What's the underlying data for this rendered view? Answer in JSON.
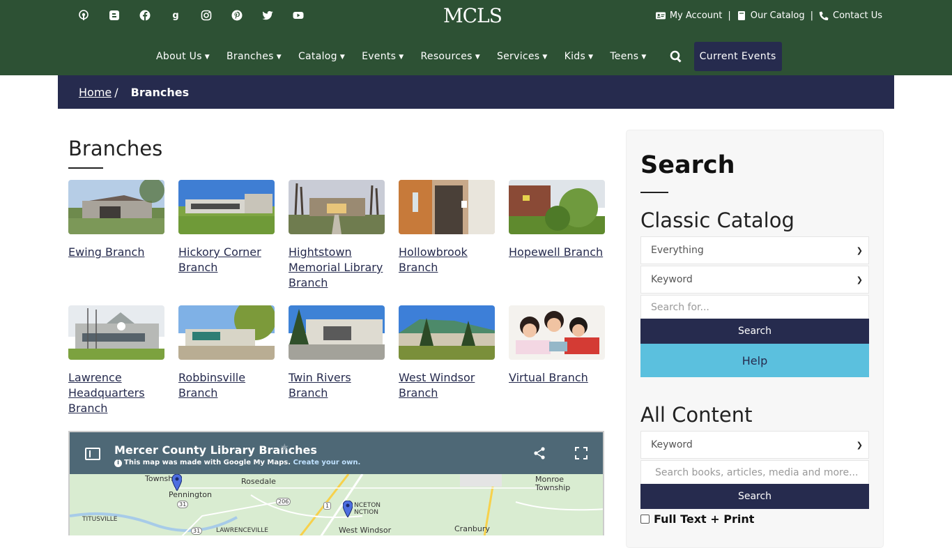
{
  "header": {
    "logo": "MCLS",
    "social_icons": [
      "podcast-icon",
      "blogger-icon",
      "facebook-icon",
      "goodreads-icon",
      "instagram-icon",
      "pinterest-icon",
      "twitter-icon",
      "youtube-icon"
    ],
    "social_glyphs": {
      "blogger": "B",
      "goodreads": "g"
    },
    "utility": {
      "account": "My Account",
      "catalog": "Our Catalog",
      "contact": "Contact Us",
      "separator": "|"
    },
    "nav": [
      "About Us",
      "Branches",
      "Catalog",
      "Events",
      "Resources",
      "Services",
      "Kids",
      "Teens"
    ],
    "current_events": "Current Events",
    "colors": {
      "header_bg": "#2d5134",
      "navy": "#262b4e",
      "help": "#5bc0de"
    }
  },
  "breadcrumb": {
    "home": "Home",
    "separator": "/",
    "current": "Branches"
  },
  "main": {
    "title": "Branches",
    "branches": [
      {
        "label": "Ewing Branch"
      },
      {
        "label": "Hickory Corner Branch"
      },
      {
        "label": "Hightstown Memorial Library Branch"
      },
      {
        "label": "Hollowbrook Branch"
      },
      {
        "label": "Hopewell Branch"
      },
      {
        "label": "Lawrence Headquarters Branch"
      },
      {
        "label": "Robbinsville Branch"
      },
      {
        "label": "Twin Rivers Branch"
      },
      {
        "label": "West Windsor Branch"
      },
      {
        "label": "Virtual Branch"
      }
    ],
    "map": {
      "title": "Mercer County Library Branches",
      "note": "This map was made with Google My Maps.",
      "note_link": "Create your own.",
      "labels": {
        "township": "Townsh",
        "pennington": "Pennington",
        "rosedale": "Rosedale",
        "titusville": "TITUSVILLE",
        "lawrenceville": "LAWRENCEVILLE",
        "princeton_junction": "NCETON\nNCTION",
        "west_windsor": "West Windsor",
        "monroe_township": "Monroe\nTownship",
        "cranbury": "Cranbury",
        "route_31": "31",
        "route_206": "206",
        "route_1": "1"
      }
    }
  },
  "sidebar": {
    "title": "Search",
    "classic": {
      "heading": "Classic Catalog",
      "select1": "Everything",
      "select2": "Keyword",
      "placeholder": "Search for...",
      "search_btn": "Search",
      "help_btn": "Help"
    },
    "all_content": {
      "heading": "All Content",
      "select": "Keyword",
      "placeholder": "Search books, articles, media and more...",
      "search_btn": "Search",
      "checkbox_label": "Full Text + Print"
    }
  }
}
